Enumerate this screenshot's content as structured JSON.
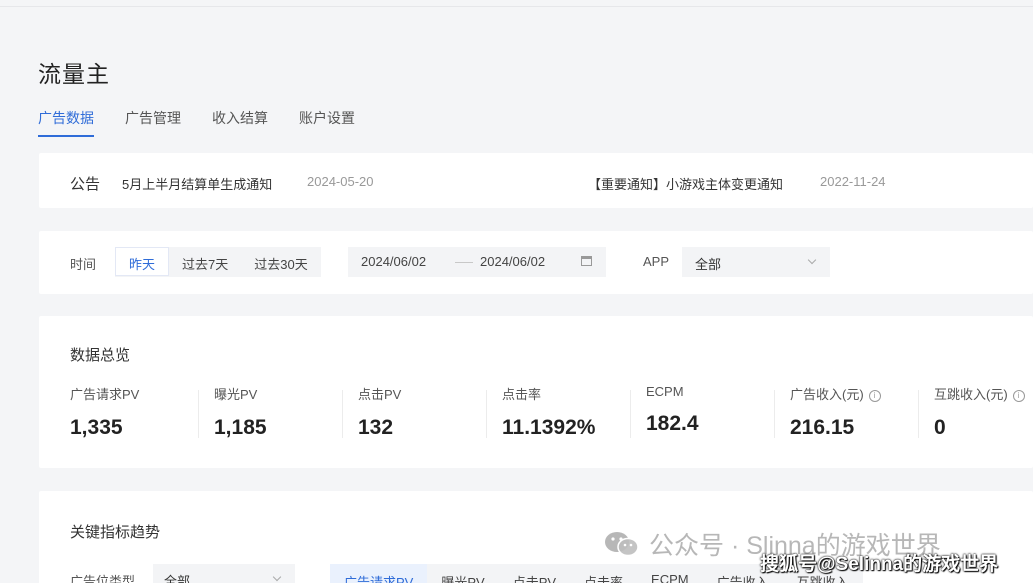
{
  "app": {
    "title": "流量主"
  },
  "nav": {
    "tabs": [
      "广告数据",
      "广告管理",
      "收入结算",
      "账户设置"
    ]
  },
  "notice": {
    "label": "公告",
    "items": [
      {
        "text": "5月上半月结算单生成通知",
        "date": "2024-05-20"
      },
      {
        "text": "【重要通知】小游戏主体变更通知",
        "date": "2022-11-24"
      }
    ]
  },
  "filters": {
    "time_label": "时间",
    "ranges": [
      "昨天",
      "过去7天",
      "过去30天"
    ],
    "date_start": "2024/06/02",
    "date_end": "2024/06/02",
    "app_label": "APP",
    "app_value": "全部"
  },
  "overview": {
    "title": "数据总览",
    "metrics": [
      {
        "label": "广告请求PV",
        "value": "1,335"
      },
      {
        "label": "曝光PV",
        "value": "1,185"
      },
      {
        "label": "点击PV",
        "value": "132"
      },
      {
        "label": "点击率",
        "value": "11.1392%"
      },
      {
        "label": "ECPM",
        "value": "182.4"
      },
      {
        "label": "广告收入(元)",
        "value": "216.15"
      },
      {
        "label": "互跳收入(元)",
        "value": "0"
      }
    ]
  },
  "trend": {
    "title": "关键指标趋势",
    "adpos_label": "广告位类型",
    "adpos_value": "全部",
    "tabs": [
      "广告请求PV",
      "曝光PV",
      "点击PV",
      "点击率",
      "ECPM",
      "广告收入",
      "互跳收入"
    ]
  },
  "watermarks": {
    "wechat": "公众号 · Slinna的游戏世界",
    "sohu": "搜狐号@Selinna的游戏世界"
  },
  "colors": {
    "accent": "#2f6cd8",
    "background": "#f4f5f7",
    "card": "#ffffff"
  }
}
